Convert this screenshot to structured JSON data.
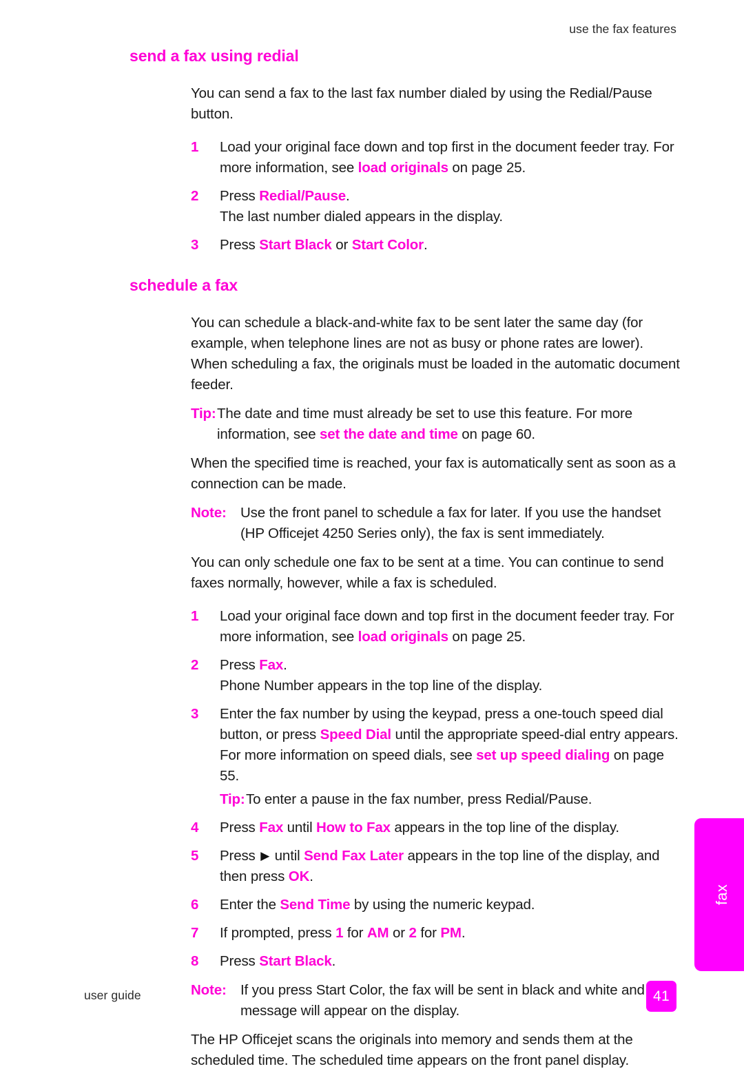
{
  "header": {
    "running_head": "use the fax features"
  },
  "colors": {
    "accent_magenta": "#ff00ff",
    "heading_magenta": "#ff00d6",
    "body_text": "#1a1a1a"
  },
  "sections": [
    {
      "id": "send-a-fax-using-redial",
      "heading": "send a fax using redial",
      "intro": "You can send a fax to the last fax number dialed by using the Redial/Pause button.",
      "steps": [
        {
          "number": "1",
          "text_before": "Load your original face down and top first in the document feeder tray. For more information, see ",
          "link": "load originals",
          "text_after": " on page 25."
        },
        {
          "number": "2",
          "text_before": "Press ",
          "ui": "Redial/Pause",
          "text_after": ".",
          "sub": "The last number dialed appears in the display."
        },
        {
          "number": "3",
          "text_before": "Press ",
          "ui": "Start Black",
          "middle": " or ",
          "ui2": "Start Color",
          "text_after": "."
        }
      ]
    },
    {
      "id": "schedule-a-fax",
      "heading": "schedule a fax",
      "intro": "You can schedule a black-and-white fax to be sent later the same day (for example, when telephone lines are not as busy or phone rates are lower). When scheduling a fax, the originals must be loaded in the automatic document feeder.",
      "tip_1": {
        "lead": "Tip:",
        "text_before": "The date and time must already be set to use this feature. For more information, see ",
        "link": "set the date and time",
        "text_after": " on page 60."
      },
      "para_2": "When the specified time is reached, your fax is automatically sent as soon as a connection can be made.",
      "note_1": {
        "lead": "Note:",
        "text": "Use the front panel to schedule a fax for later. If you use the handset (HP Officejet 4250 Series only), the fax is sent immediately."
      },
      "para_3": "You can only schedule one fax to be sent at a time. You can continue to send faxes normally, however, while a fax is scheduled.",
      "steps": [
        {
          "number": "1",
          "text_before": "Load your original face down and top first in the document feeder tray. For more information, see ",
          "link": "load originals",
          "text_after": " on page 25."
        },
        {
          "number": "2",
          "text_before": "Press ",
          "ui": "Fax",
          "text_after": ".",
          "sub": "Phone Number appears in the top line of the display."
        },
        {
          "number": "3",
          "text_before": "Enter the fax number by using the keypad, press a one-touch speed dial button, or press ",
          "ui": "Speed Dial",
          "middle": " until the appropriate speed-dial entry appears. For more information on speed dials, see ",
          "link": "set up speed dialing",
          "text_after": " on page 55.",
          "tip": {
            "lead": "Tip:",
            "text": "To enter a pause in the fax number, press Redial/Pause."
          }
        },
        {
          "number": "4",
          "text_before": "Press ",
          "ui": "Fax",
          "middle": " until ",
          "ui2": "How to Fax",
          "text_after": " appears in the top line of the display."
        },
        {
          "number": "5",
          "text_before": "Press ",
          "arrow": "▶",
          "middle": " until ",
          "ui2": "Send Fax Later",
          "middle2": " appears in the top line of the display, and then press ",
          "ui3": "OK",
          "text_after": "."
        },
        {
          "number": "6",
          "text_before": "Enter the ",
          "ui": "Send Time",
          "text_after": " by using the numeric keypad."
        },
        {
          "number": "7",
          "text_before": "If prompted, press ",
          "ui": "1",
          "middle": " for ",
          "ui2": "AM",
          "middle2": " or ",
          "ui3": "2",
          "middle3": " for ",
          "ui4": "PM",
          "text_after": "."
        },
        {
          "number": "8",
          "text_before": "Press ",
          "ui": "Start Black",
          "text_after": "."
        }
      ],
      "note_2": {
        "lead": "Note:",
        "text": "If you press Start Color, the fax will be sent in black and white and a message will appear on the display."
      },
      "para_4": "The HP Officejet scans the originals into memory and sends them at the scheduled time. The scheduled time appears on the front panel display."
    }
  ],
  "thumb_tab": {
    "label": "fax"
  },
  "footer": {
    "guide_label": "user guide",
    "page_number": "41"
  }
}
